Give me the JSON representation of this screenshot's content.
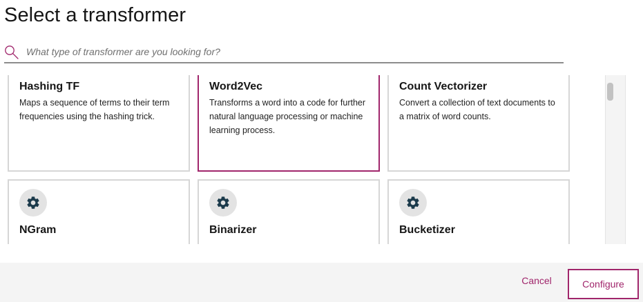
{
  "page": {
    "title": "Select a transformer"
  },
  "search": {
    "placeholder": "What type of transformer are you looking for?",
    "value": ""
  },
  "cards": [
    {
      "title": "Hashing TF",
      "description": "Maps a sequence of terms to their term frequencies using the hashing trick.",
      "selected": false
    },
    {
      "title": "Word2Vec",
      "description": "Transforms a word into a code for further natural language processing or machine learning process.",
      "selected": true
    },
    {
      "title": "Count Vectorizer",
      "description": "Convert a collection of text documents to a matrix of word counts.",
      "selected": false
    },
    {
      "title": "NGram",
      "icon": "gear-icon",
      "selected": false
    },
    {
      "title": "Binarizer",
      "icon": "gear-icon",
      "selected": false
    },
    {
      "title": "Bucketizer",
      "icon": "gear-icon",
      "selected": false
    }
  ],
  "footer": {
    "cancel_label": "Cancel",
    "configure_label": "Configure"
  },
  "colors": {
    "accent": "#a0256b",
    "icon": "#1b3a4b",
    "icon_bg": "#e3e3e3",
    "card_border": "#d6d6d6"
  }
}
